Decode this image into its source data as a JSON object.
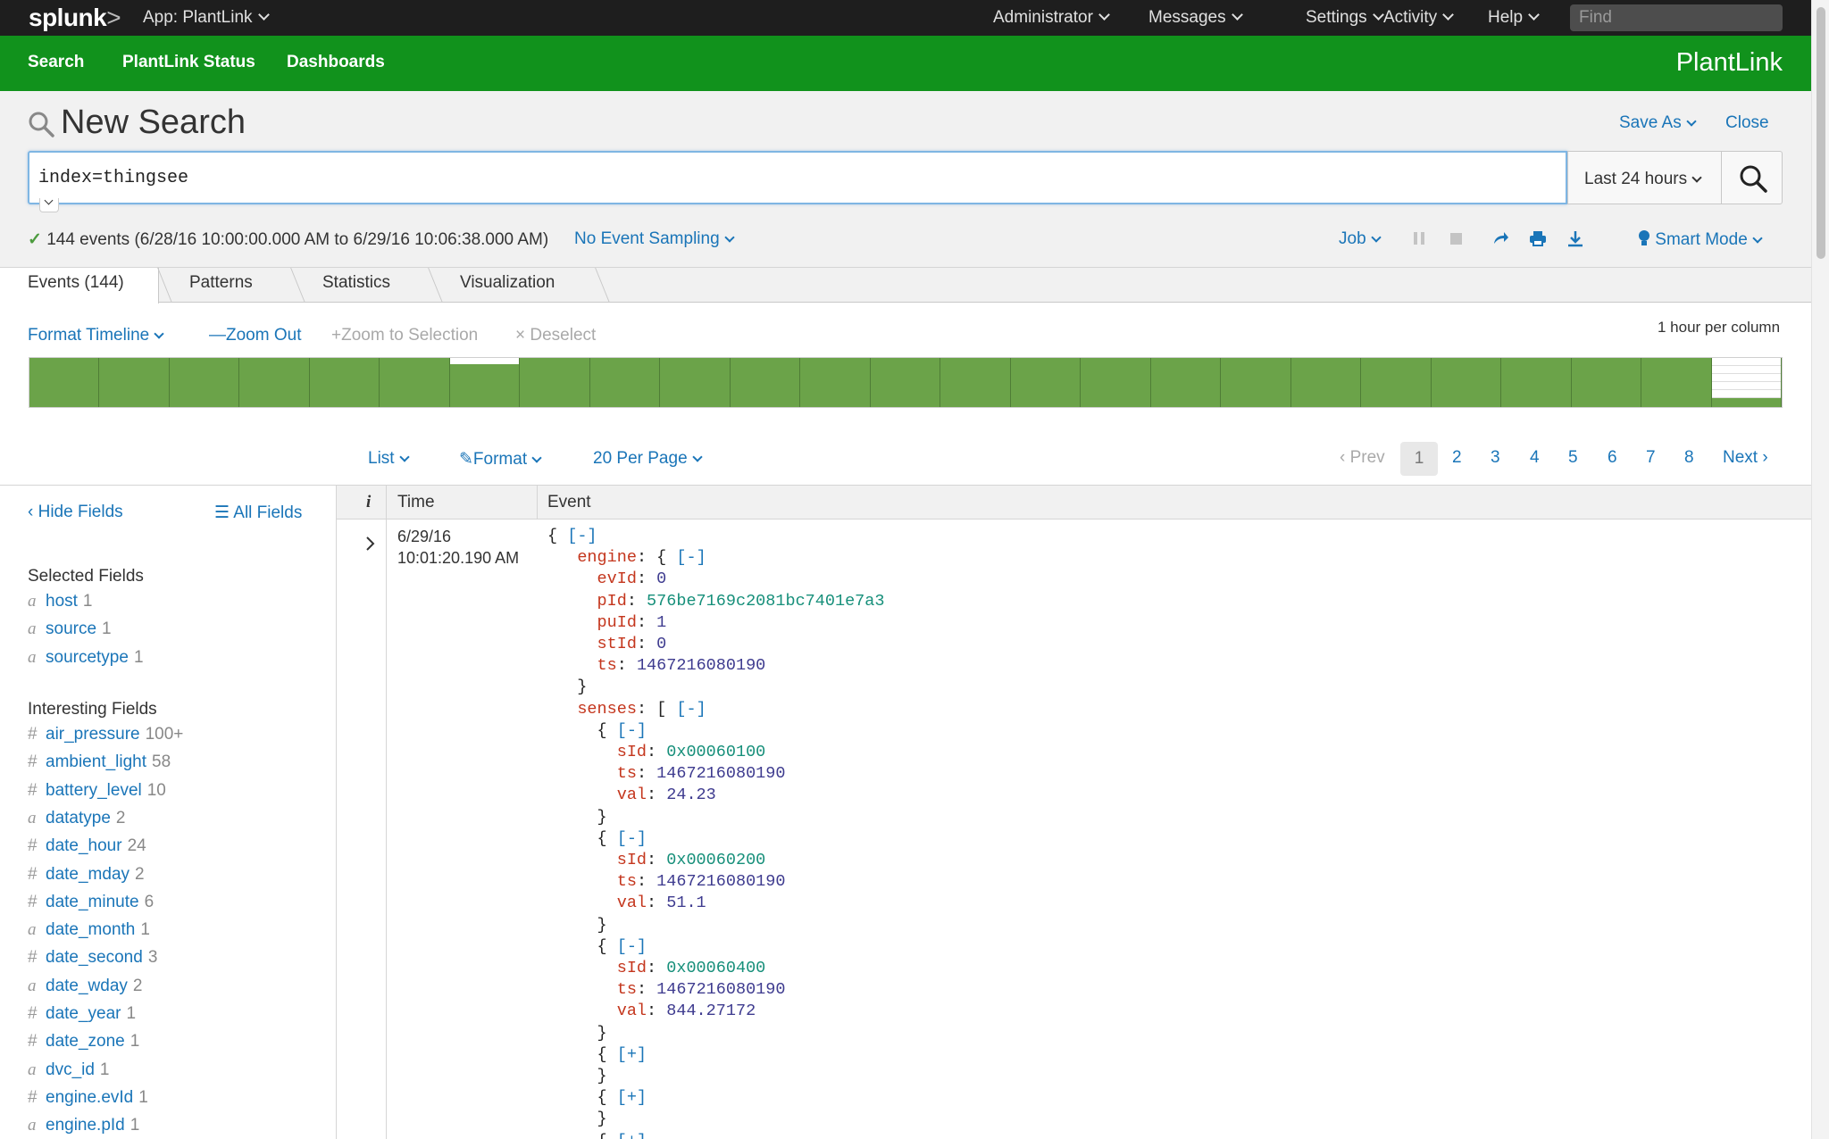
{
  "topbar": {
    "logo": "splunk",
    "logo_suffix": ">",
    "app_menu": "App: PlantLink",
    "menus": [
      "Administrator",
      "Messages",
      "Settings",
      "Activity",
      "Help"
    ],
    "find_placeholder": "Find"
  },
  "appbar": {
    "nav": [
      "Search",
      "PlantLink Status",
      "Dashboards"
    ],
    "app_title": "PlantLink"
  },
  "search": {
    "title": "New Search",
    "save_as": "Save As",
    "close": "Close",
    "query": "index=thingsee",
    "time_range": "Last 24 hours",
    "status": "144 events (6/28/16 10:00:00.000 AM to 6/29/16 10:06:38.000 AM)",
    "sampling": "No Event Sampling",
    "job": "Job",
    "mode": "Smart Mode"
  },
  "tabs": [
    "Events (144)",
    "Patterns",
    "Statistics",
    "Visualization"
  ],
  "timeline": {
    "format": "Format Timeline",
    "zoom_out": "Zoom Out",
    "zoom_selection": "Zoom to Selection",
    "deselect": "Deselect",
    "per_column": "1 hour per column",
    "bars": [
      1,
      1,
      1,
      1,
      1,
      1,
      0.88,
      1,
      1,
      1,
      1,
      1,
      1,
      1,
      1,
      1,
      1,
      1,
      1,
      1,
      1,
      1,
      1,
      1,
      0.18
    ]
  },
  "listbar": {
    "list": "List",
    "format": "Format",
    "per_page": "20 Per Page",
    "prev": "Prev",
    "pages": [
      "1",
      "2",
      "3",
      "4",
      "5",
      "6",
      "7",
      "8"
    ],
    "next": "Next"
  },
  "sidebar": {
    "hide_fields": "Hide Fields",
    "all_fields": "All Fields",
    "selected_heading": "Selected Fields",
    "selected": [
      {
        "type": "a",
        "name": "host",
        "count": "1"
      },
      {
        "type": "a",
        "name": "source",
        "count": "1"
      },
      {
        "type": "a",
        "name": "sourcetype",
        "count": "1"
      }
    ],
    "interesting_heading": "Interesting Fields",
    "interesting": [
      {
        "type": "#",
        "name": "air_pressure",
        "count": "100+"
      },
      {
        "type": "#",
        "name": "ambient_light",
        "count": "58"
      },
      {
        "type": "#",
        "name": "battery_level",
        "count": "10"
      },
      {
        "type": "a",
        "name": "datatype",
        "count": "2"
      },
      {
        "type": "#",
        "name": "date_hour",
        "count": "24"
      },
      {
        "type": "#",
        "name": "date_mday",
        "count": "2"
      },
      {
        "type": "#",
        "name": "date_minute",
        "count": "6"
      },
      {
        "type": "a",
        "name": "date_month",
        "count": "1"
      },
      {
        "type": "#",
        "name": "date_second",
        "count": "3"
      },
      {
        "type": "a",
        "name": "date_wday",
        "count": "2"
      },
      {
        "type": "#",
        "name": "date_year",
        "count": "1"
      },
      {
        "type": "#",
        "name": "date_zone",
        "count": "1"
      },
      {
        "type": "a",
        "name": "dvc_id",
        "count": "1"
      },
      {
        "type": "#",
        "name": "engine.evId",
        "count": "1"
      },
      {
        "type": "a",
        "name": "engine.pId",
        "count": "1"
      }
    ]
  },
  "events": {
    "col_info": "i",
    "col_time": "Time",
    "col_event": "Event",
    "row": {
      "date": "6/29/16",
      "time": "10:01:20.190 AM",
      "engine": {
        "evId": "0",
        "pId": "576be7169c2081bc7401e7a3",
        "puId": "1",
        "stId": "0",
        "ts": "1467216080190"
      },
      "senses": [
        {
          "sId": "0x00060100",
          "ts": "1467216080190",
          "val": "24.23"
        },
        {
          "sId": "0x00060200",
          "ts": "1467216080190",
          "val": "51.1"
        },
        {
          "sId": "0x00060400",
          "ts": "1467216080190",
          "val": "844.27172"
        }
      ],
      "collapse": "[-]",
      "expand": "[+]"
    }
  }
}
